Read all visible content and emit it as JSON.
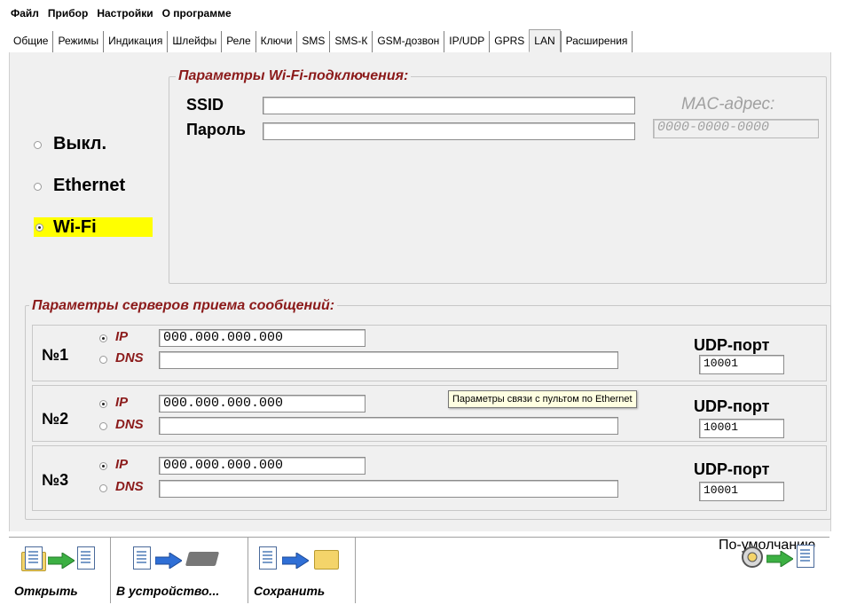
{
  "menu": [
    "Файл",
    "Прибор",
    "Настройки",
    "О программе"
  ],
  "tabs": [
    "Общие",
    "Режимы",
    "Индикация",
    "Шлейфы",
    "Реле",
    "Ключи",
    "SMS",
    "SMS-К",
    "GSM-дозвон",
    "IP/UDP",
    "GPRS",
    "LAN",
    "Расширения"
  ],
  "active_tab": "LAN",
  "mode": {
    "options": [
      "Выкл.",
      "Ethernet",
      "Wi-Fi"
    ],
    "selected": "Wi-Fi",
    "highlight_color": "#ffff00"
  },
  "wifi": {
    "title": "Параметры Wi-Fi-подключения:",
    "ssid_label": "SSID",
    "ssid_value": "",
    "password_label": "Пароль",
    "password_value": "",
    "mac_label": "MAC-адрес:",
    "mac_value": "0000-0000-0000"
  },
  "servers": {
    "title": "Параметры серверов приема сообщений:",
    "items": [
      {
        "num": "№1",
        "ip_label": "IP",
        "dns_label": "DNS",
        "ip": "000.000.000.000",
        "dns": "",
        "selected": "IP",
        "udp_label": "UDP-порт",
        "udp": "10001"
      },
      {
        "num": "№2",
        "ip_label": "IP",
        "dns_label": "DNS",
        "ip": "000.000.000.000",
        "dns": "",
        "selected": "IP",
        "udp_label": "UDP-порт",
        "udp": "10001"
      },
      {
        "num": "№3",
        "ip_label": "IP",
        "dns_label": "DNS",
        "ip": "000.000.000.000",
        "dns": "",
        "selected": "IP",
        "udp_label": "UDP-порт",
        "udp": "10001"
      }
    ]
  },
  "tooltip": "Параметры связи с пультом по Ethernet",
  "toolbar": {
    "open": "Открыть",
    "to_device": "В устройство...",
    "save": "Сохранить",
    "defaults": "По-умолчанию"
  },
  "colors": {
    "group_title": "#8b1a1a",
    "panel_bg": "#f0f0f0",
    "tooltip_bg": "#ffffe1"
  }
}
